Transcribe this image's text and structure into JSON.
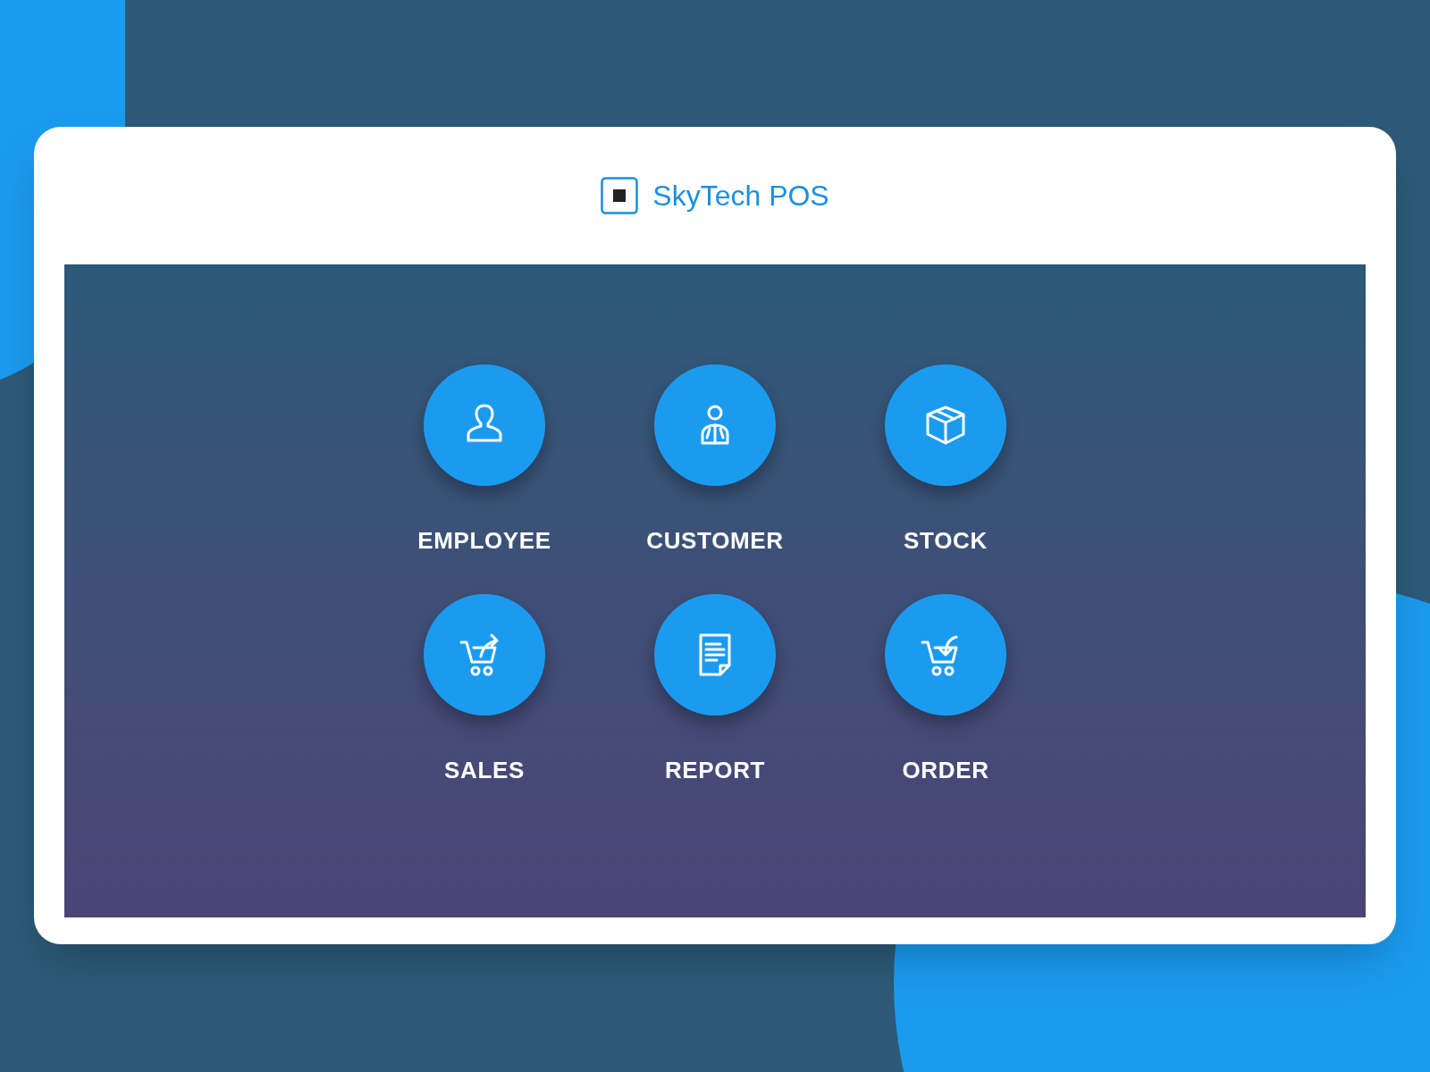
{
  "app": {
    "title": "SkyTech POS"
  },
  "menu": [
    {
      "label": "EMPLOYEE",
      "kind": "employee"
    },
    {
      "label": "CUSTOMER",
      "kind": "customer"
    },
    {
      "label": "STOCK",
      "kind": "stock"
    },
    {
      "label": "SALES",
      "kind": "sales"
    },
    {
      "label": "REPORT",
      "kind": "report"
    },
    {
      "label": "ORDER",
      "kind": "order"
    }
  ]
}
